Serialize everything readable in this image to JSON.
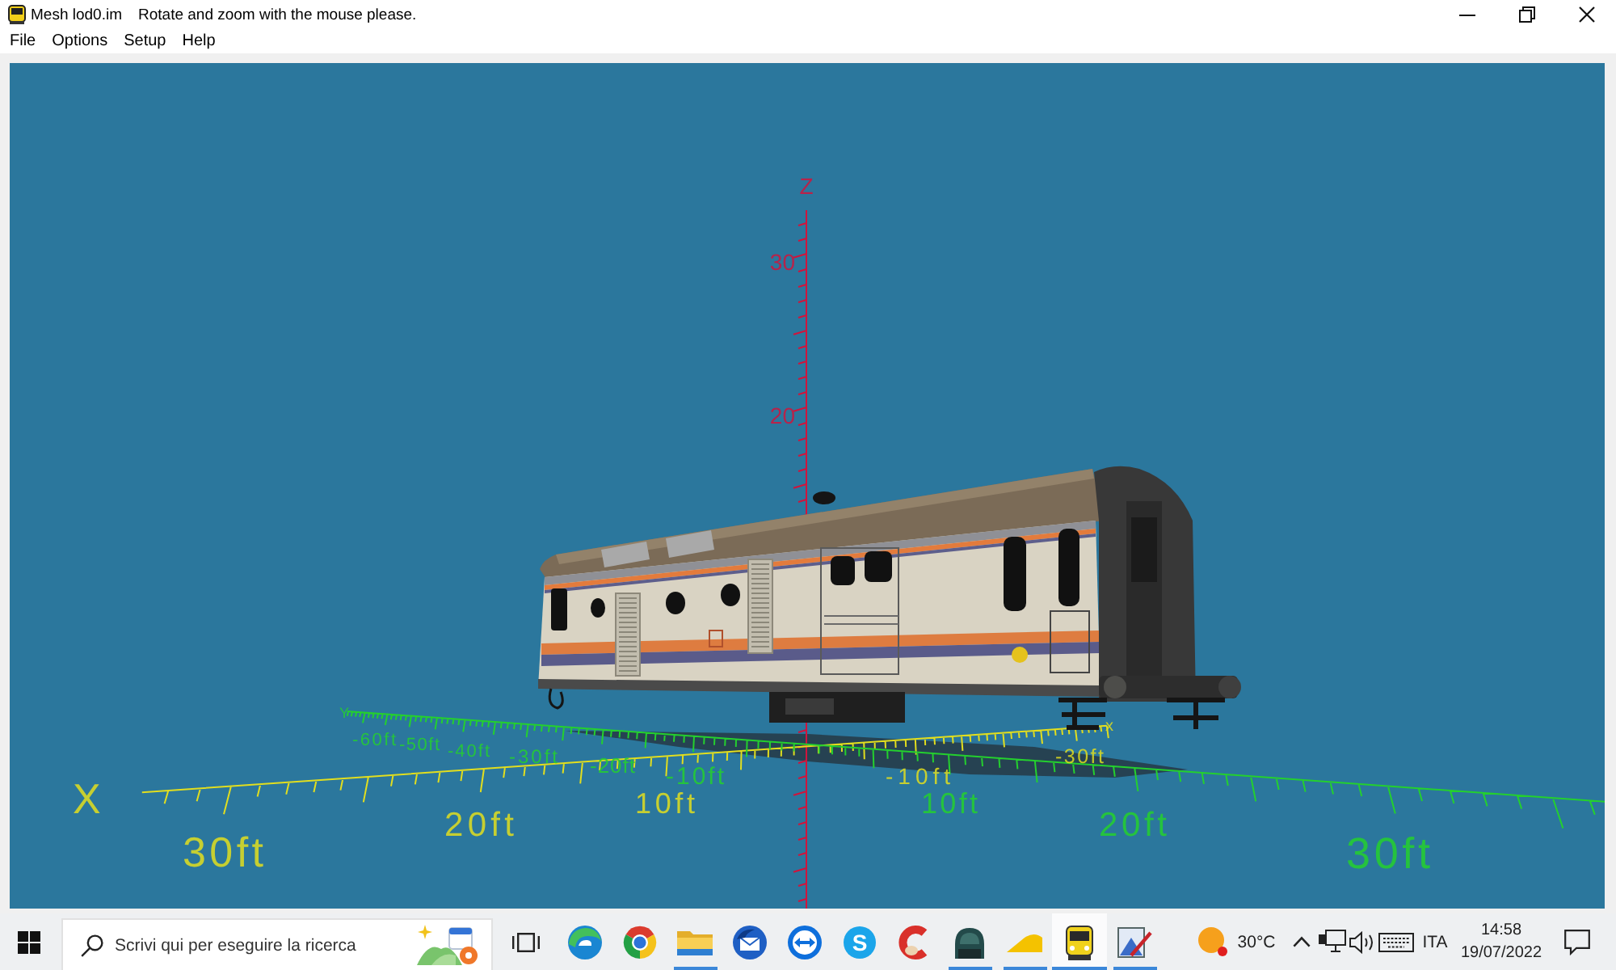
{
  "window": {
    "title": "Mesh lod0.im",
    "hint": "Rotate and zoom with the mouse please."
  },
  "menu": [
    {
      "label": "File"
    },
    {
      "label": "Options"
    },
    {
      "label": "Setup"
    },
    {
      "label": "Help"
    }
  ],
  "viewport": {
    "axes": [
      {
        "kind": "z",
        "name": "Z",
        "color": "#d0143c",
        "labels": [
          "30",
          "20"
        ]
      },
      {
        "kind": "x",
        "name": "X",
        "end_label": "x",
        "color": "#e2de1e",
        "labels": [
          "30ft",
          "20ft",
          "10ft",
          "-10ft",
          "-30ft"
        ]
      },
      {
        "kind": "y",
        "end_label": "Y",
        "color": "#24d02e",
        "labels": [
          "-60ft",
          "-50ft",
          "-40ft",
          "-30ft",
          "-20ft",
          "-10ft",
          "10ft",
          "20ft",
          "30ft"
        ]
      }
    ]
  },
  "taskbar": {
    "search": {
      "placeholder": "Scrivi qui per eseguire la ricerca"
    },
    "apps": [
      {
        "kind": "swirl",
        "running": false,
        "selected": false
      },
      {
        "kind": "ring",
        "running": false,
        "selected": false
      },
      {
        "kind": "folder",
        "running": true,
        "selected": false
      },
      {
        "kind": "envelope",
        "running": false,
        "selected": false
      },
      {
        "kind": "arrows",
        "running": false,
        "selected": false
      },
      {
        "kind": "letter",
        "glyph": "S",
        "running": false,
        "selected": false
      },
      {
        "kind": "arc",
        "running": false,
        "selected": false
      },
      {
        "kind": "dome",
        "running": true,
        "selected": false
      },
      {
        "kind": "wedge",
        "running": true,
        "selected": false
      },
      {
        "kind": "bus",
        "running": true,
        "selected": true
      },
      {
        "kind": "easel",
        "running": true,
        "selected": false
      }
    ],
    "weather": {
      "temperature": "30°C"
    },
    "language": "ITA",
    "clock": {
      "time": "14:58",
      "date": "19/07/2022"
    }
  }
}
